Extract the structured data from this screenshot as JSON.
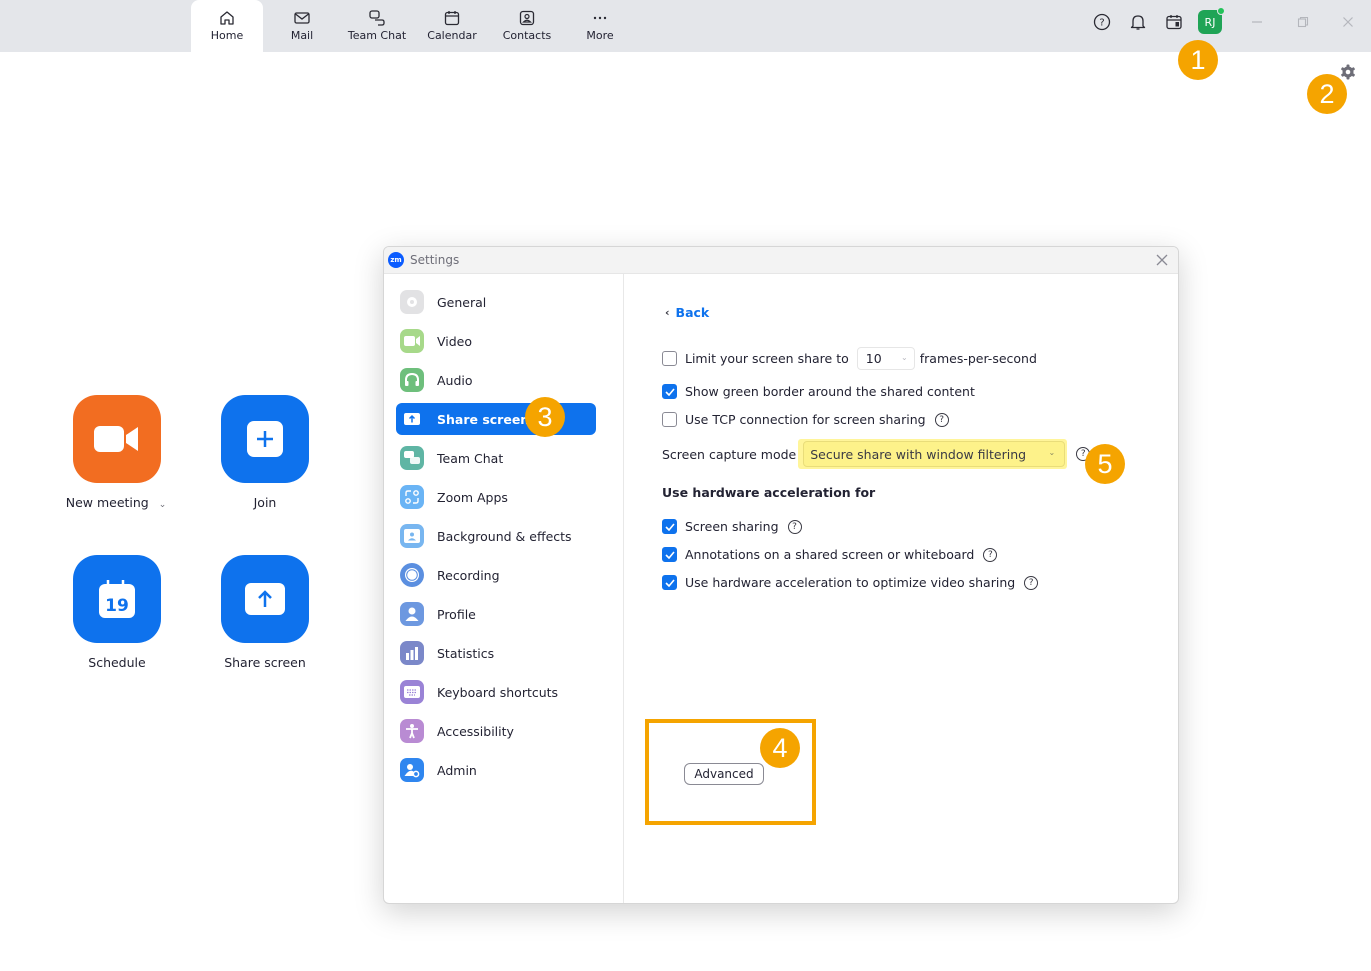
{
  "topbar": {
    "tabs": [
      {
        "label": "Home",
        "icon": "home-icon",
        "active": true
      },
      {
        "label": "Mail",
        "icon": "mail-icon",
        "active": false
      },
      {
        "label": "Team Chat",
        "icon": "chat-icon",
        "active": false
      },
      {
        "label": "Calendar",
        "icon": "calendar-icon",
        "active": false
      },
      {
        "label": "Contacts",
        "icon": "contacts-icon",
        "active": false
      },
      {
        "label": "More",
        "icon": "more-icon",
        "active": false
      }
    ],
    "avatar_initials": "RJ",
    "status_color": "#23c25a"
  },
  "home": {
    "new_meeting": "New meeting",
    "join": "Join",
    "schedule": "Schedule",
    "schedule_day": "19",
    "share_screen": "Share screen",
    "colors": {
      "orange": "#f26d21",
      "blue": "#0e72ed"
    }
  },
  "annotations": [
    "1",
    "2",
    "3",
    "4",
    "5"
  ],
  "settings": {
    "title": "Settings",
    "logo": "zm",
    "sidebar": [
      {
        "label": "General",
        "icon": "gear-icon"
      },
      {
        "label": "Video",
        "icon": "video-icon"
      },
      {
        "label": "Audio",
        "icon": "headphones-icon"
      },
      {
        "label": "Share screen",
        "icon": "share-screen-icon",
        "active": true
      },
      {
        "label": "Team Chat",
        "icon": "chat-icon"
      },
      {
        "label": "Zoom Apps",
        "icon": "apps-icon"
      },
      {
        "label": "Background & effects",
        "icon": "background-icon"
      },
      {
        "label": "Recording",
        "icon": "recording-icon"
      },
      {
        "label": "Profile",
        "icon": "profile-icon"
      },
      {
        "label": "Statistics",
        "icon": "statistics-icon"
      },
      {
        "label": "Keyboard shortcuts",
        "icon": "keyboard-icon"
      },
      {
        "label": "Accessibility",
        "icon": "accessibility-icon"
      },
      {
        "label": "Admin",
        "icon": "admin-icon"
      }
    ],
    "content": {
      "back": "Back",
      "limit_label": "Limit your screen share to",
      "limit_checked": false,
      "fps_value": "10",
      "fps_suffix": "frames-per-second",
      "green_border": "Show green border around the shared content",
      "green_border_checked": true,
      "tcp": "Use TCP connection for screen sharing",
      "tcp_checked": false,
      "capture_mode_label": "Screen capture mode",
      "capture_mode_value": "Secure share with window filtering",
      "hw_heading": "Use hardware acceleration for",
      "hw_screen_sharing": "Screen sharing",
      "hw_annotations": "Annotations on a shared screen or whiteboard",
      "hw_video": "Use hardware acceleration to optimize video sharing",
      "advanced": "Advanced",
      "help_glyph": "?"
    }
  }
}
